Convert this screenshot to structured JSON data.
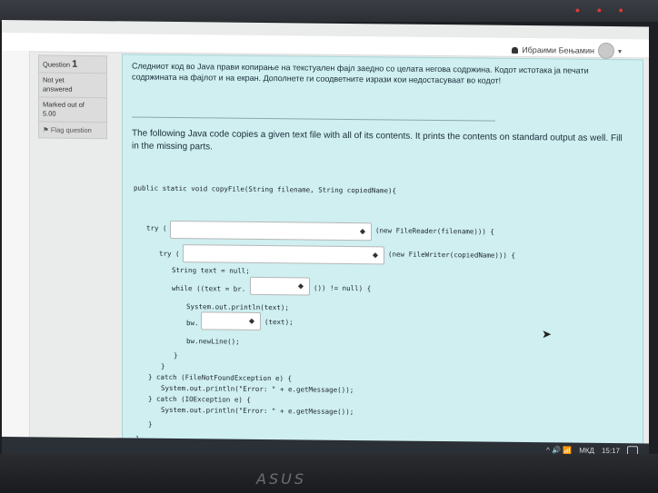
{
  "user": {
    "name": "Ибраими Бењамин"
  },
  "info": {
    "question_label": "Question",
    "question_number": "1",
    "status_line1": "Not yet",
    "status_line2": "answered",
    "marked_label": "Marked out of",
    "marked_value": "5.00",
    "flag_label": "Flag question"
  },
  "question": {
    "mk_text": "Следниот код во Java прави копирање на текстуален фајл заедно со целата негова содржина. Кодот истотака ја печати содржината на фајлот и на екран. Дополнете ги соодветните изрази кои недостасуваат во кодот!",
    "en_text": "The following Java code copies a given text file with all of its contents. It prints the contents on standard output as well. Fill in the missing parts."
  },
  "code": {
    "signature": "public static void copyFile(String filename, String copiedName){",
    "try1_prefix": "try (",
    "try1_suffix": "(new FileReader(filename))) {",
    "try2_prefix": "try (",
    "try2_suffix": "(new FileWriter(copiedName))) {",
    "string_decl": "String text = null;",
    "while_prefix": "while ((text = br.",
    "while_suffix": "()) != null) {",
    "println_text": "System.out.println(text);",
    "bw_prefix": "bw.",
    "bw_suffix": "(text);",
    "newline": "bw.newLine();",
    "close1": "}",
    "close2": "}",
    "catch1": "} catch (FileNotFoundException e) {",
    "catch1_body": "System.out.println(\"Error: \" + e.getMessage());",
    "catch2": "} catch (IOException e) {",
    "catch2_body": "System.out.println(\"Error: \" + e.getMessage());",
    "close3": "}",
    "close4": "}"
  },
  "selects": {
    "arrow": "◆"
  },
  "tray": {
    "lang": "МКД",
    "time": "15:17",
    "icons": "^ 🔊 📶"
  },
  "brand": "ASUS",
  "colors": {
    "content_bg": "#cfeff0",
    "panel_bg": "#dcdcdc"
  }
}
